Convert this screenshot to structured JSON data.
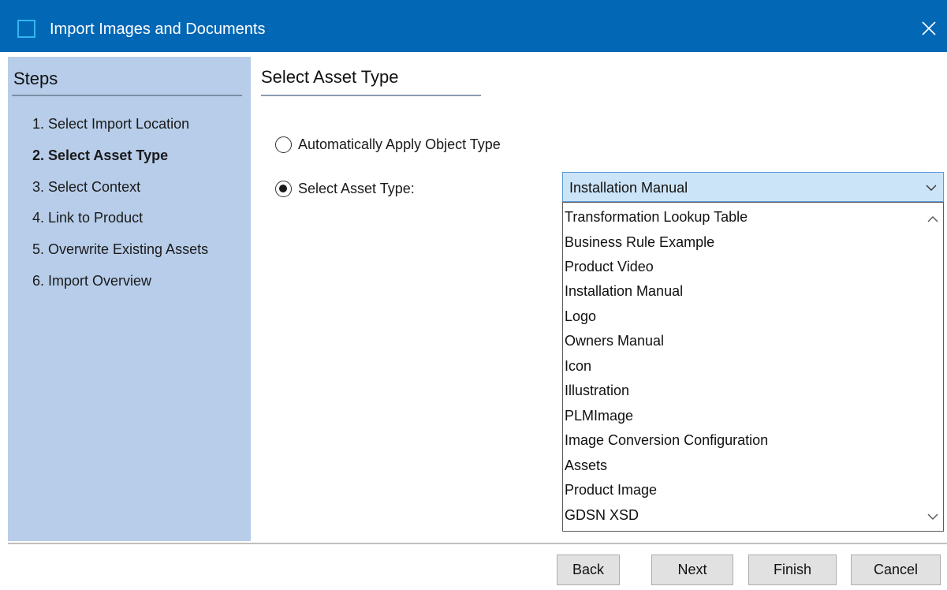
{
  "window": {
    "title": "Import Images and Documents",
    "icon": "window-app-icon",
    "close_icon": "close-icon"
  },
  "steps": {
    "heading": "Steps",
    "items": [
      {
        "label": "1. Select Import Location",
        "active": false
      },
      {
        "label": "2. Select Asset Type",
        "active": true
      },
      {
        "label": "3. Select Context",
        "active": false
      },
      {
        "label": "4. Link to Product",
        "active": false
      },
      {
        "label": "5. Overwrite Existing Assets",
        "active": false
      },
      {
        "label": "6. Import Overview",
        "active": false
      }
    ]
  },
  "main": {
    "title": "Select Asset Type",
    "options": [
      {
        "label": "Automatically Apply Object Type",
        "selected": false
      },
      {
        "label": "Select Asset Type:",
        "selected": true
      }
    ],
    "asset_type": {
      "selected_value": "Installation Manual",
      "list_items": [
        "Transformation Lookup Table",
        "Business Rule Example",
        "Product Video",
        "Installation Manual",
        "Logo",
        "Owners Manual",
        "Icon",
        "Illustration",
        "PLMImage",
        "Image Conversion Configuration",
        "Assets",
        "Product Image",
        "GDSN XSD"
      ]
    }
  },
  "footer": {
    "back_label": "Back",
    "next_label": "Next",
    "finish_label": "Finish",
    "cancel_label": "Cancel"
  },
  "colors": {
    "titlebar": "#0267b5",
    "steps_panel": "#b7cde9",
    "combo_highlight": "#cce4f7",
    "combo_border": "#5a9ad6"
  }
}
